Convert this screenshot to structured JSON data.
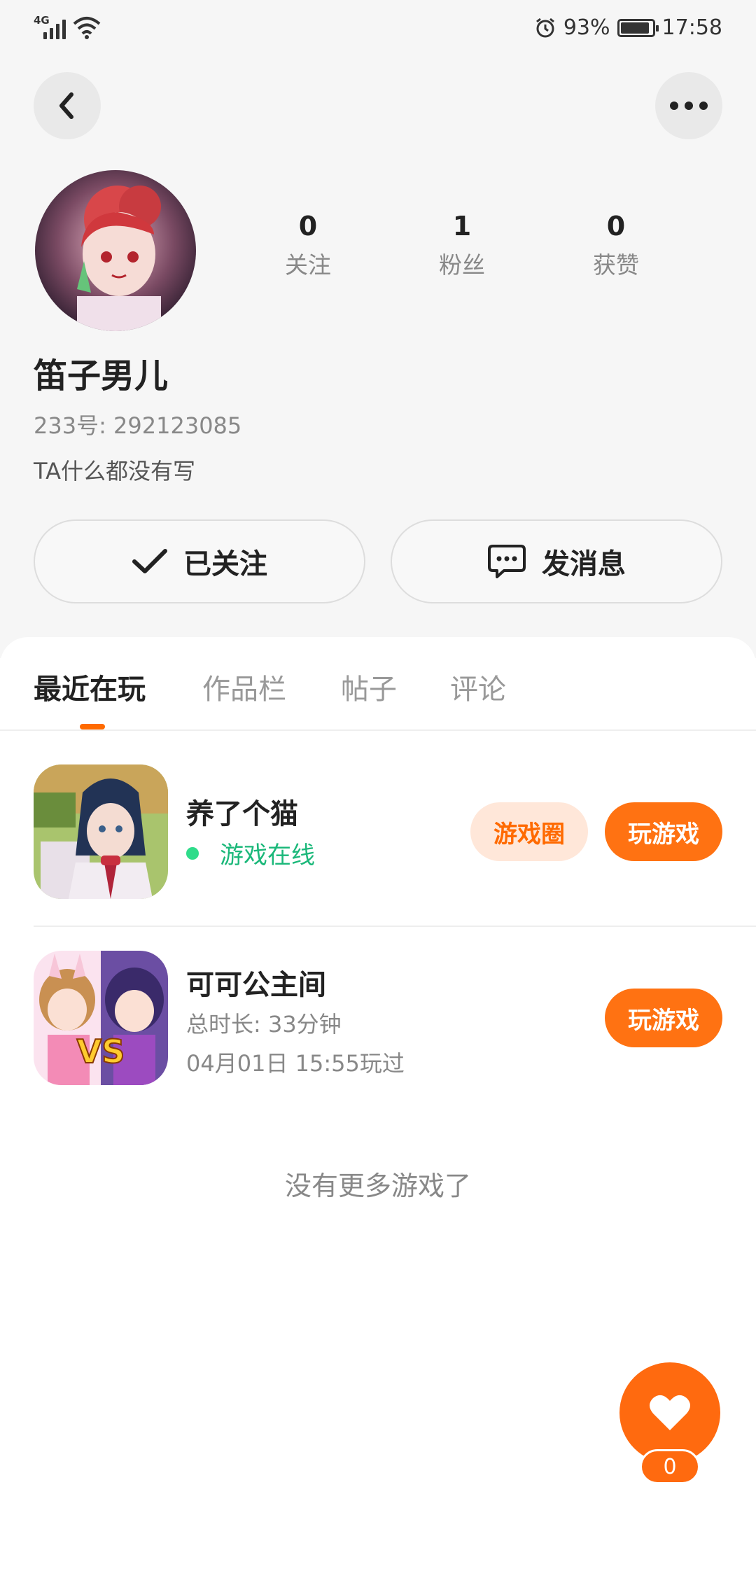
{
  "status_bar": {
    "network": "4G",
    "battery": "93%",
    "battery_level": 0.93,
    "time": "17:58"
  },
  "header": {
    "back_icon": "chevron-left-icon",
    "more_icon": "more-dots-icon"
  },
  "profile": {
    "name": "笛子男儿",
    "uid": "233号: 292123085",
    "bio": "TA什么都没有写",
    "stats": [
      {
        "value": "0",
        "label": "关注"
      },
      {
        "value": "1",
        "label": "粉丝"
      },
      {
        "value": "0",
        "label": "获赞"
      }
    ]
  },
  "actions": {
    "follow_label": "已关注",
    "message_label": "发消息"
  },
  "tabs": [
    {
      "label": "最近在玩",
      "active": true
    },
    {
      "label": "作品栏",
      "active": false
    },
    {
      "label": "帖子",
      "active": false
    },
    {
      "label": "评论",
      "active": false
    }
  ],
  "games": [
    {
      "title": "养了个猫",
      "status": "游戏在线",
      "circle_label": "游戏圈",
      "play_label": "玩游戏"
    },
    {
      "title": "可可公主间",
      "duration": "总时长: 33分钟",
      "last_played": "04月01日 15:55玩过",
      "badge": "VS",
      "play_label": "玩游戏"
    }
  ],
  "no_more_text": "没有更多游戏了",
  "like": {
    "count": "0",
    "icon": "heart-icon"
  },
  "colors": {
    "accent": "#ff7212",
    "online": "#1bb87a"
  }
}
